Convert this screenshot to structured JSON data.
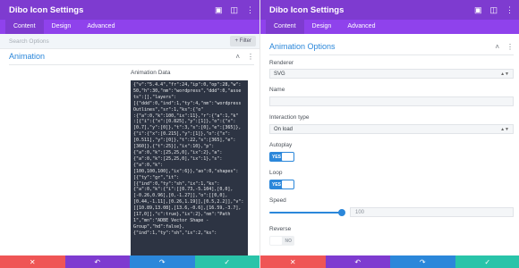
{
  "left_panel": {
    "title": "Dibo Icon Settings",
    "tabs": [
      "Content",
      "Design",
      "Advanced"
    ],
    "search_placeholder": "Search Options",
    "filter_label": "+ Filter",
    "section_title": "Animation",
    "field_label": "Animation Data",
    "code_lines": [
      "{\"v\":\"5.4.4\",\"fr\":24,\"ip\":0,\"op\":28,\"w\":",
      "50,\"h\":30,\"nm\":\"wordpress\",\"ddd\":0,\"asse",
      "ts\":[],\"layers\":",
      "[{\"ddd\":0,\"ind\":1,\"ty\":4,\"nm\":\"wordpress",
      "Outlines\",\"sr\":1,\"ks\":{\"o\"",
      ":{\"a\":0,\"k\":100,\"ix\":11},\"r\":{\"a\":1,\"k\"",
      ":[{\"i\":{\"x\":[0.825],\"y\":[1]},\"o\":{\"x\":",
      "[0.7],\"y\":[0]},\"t\":3,\"s\":[0],\"e\":[365]},",
      "{\"i\":{\"x\":[0.215],\"y\":[1]},\"o\":{\"x\":",
      "[0.511],\"y\":[0]},\"t\":22,\"s\":[365],\"e\":",
      "[360]},{\"t\":25}],\"ix\":10},\"p\":",
      "{\"a\":0,\"k\":[25,25,0],\"ix\":2},\"a\":",
      "{\"a\":0,\"k\":[25,25,0],\"ix\":1},\"s\":",
      "{\"a\":0,\"k\":",
      "[100,100,100],\"ix\":6}},\"ao\":0,\"shapes\":",
      "[{\"ty\":\"gr\",\"it\":",
      "[{\"ind\":0,\"ty\":\"sh\",\"ix\":1,\"ks\":",
      "{\"a\":0,\"k\":{\"i\":[[0.73,-5.104],[0,0],",
      "[-0.26,0.96],[0,-1.27]],\"o\":[[0,0],",
      "[0.44,-1.11],[0.26,1.19]],[0.5,2.2]],\"v\":",
      "[[10.89,13.08],[13.6,-0.6],[16.59,-3.7],",
      "[17,0]],\"c\":true},\"ix\":2},\"nm\":\"Path",
      "1\",\"mn\":\"ADBE Vector Shape -",
      "Group\",\"hd\":false},",
      "{\"ind\":1,\"ty\":\"sh\",\"ix\":2,\"ks\":"
    ]
  },
  "right_panel": {
    "title": "Dibo Icon Settings",
    "tabs": [
      "Content",
      "Design",
      "Advanced"
    ],
    "section_title": "Animation Options",
    "renderer_label": "Renderer",
    "renderer_value": "SVG",
    "name_label": "Name",
    "name_value": "",
    "interaction_label": "Interaction type",
    "interaction_value": "On load",
    "autoplay_label": "Autoplay",
    "autoplay_value": "YES",
    "loop_label": "Loop",
    "loop_value": "YES",
    "speed_label": "Speed",
    "speed_value": "100",
    "speed_fraction": 1.0,
    "reverse_label": "Reverse",
    "reverse_value": "NO"
  },
  "footer_icons": [
    "close-icon",
    "undo-icon",
    "redo-icon",
    "check-icon"
  ],
  "colors": {
    "header": "#7e3bd0",
    "tabs": "#8f42ec",
    "accent_blue": "#2b87da",
    "cancel_red": "#ef5555",
    "save_green": "#29c4a9",
    "code_bg": "#2d3443"
  }
}
